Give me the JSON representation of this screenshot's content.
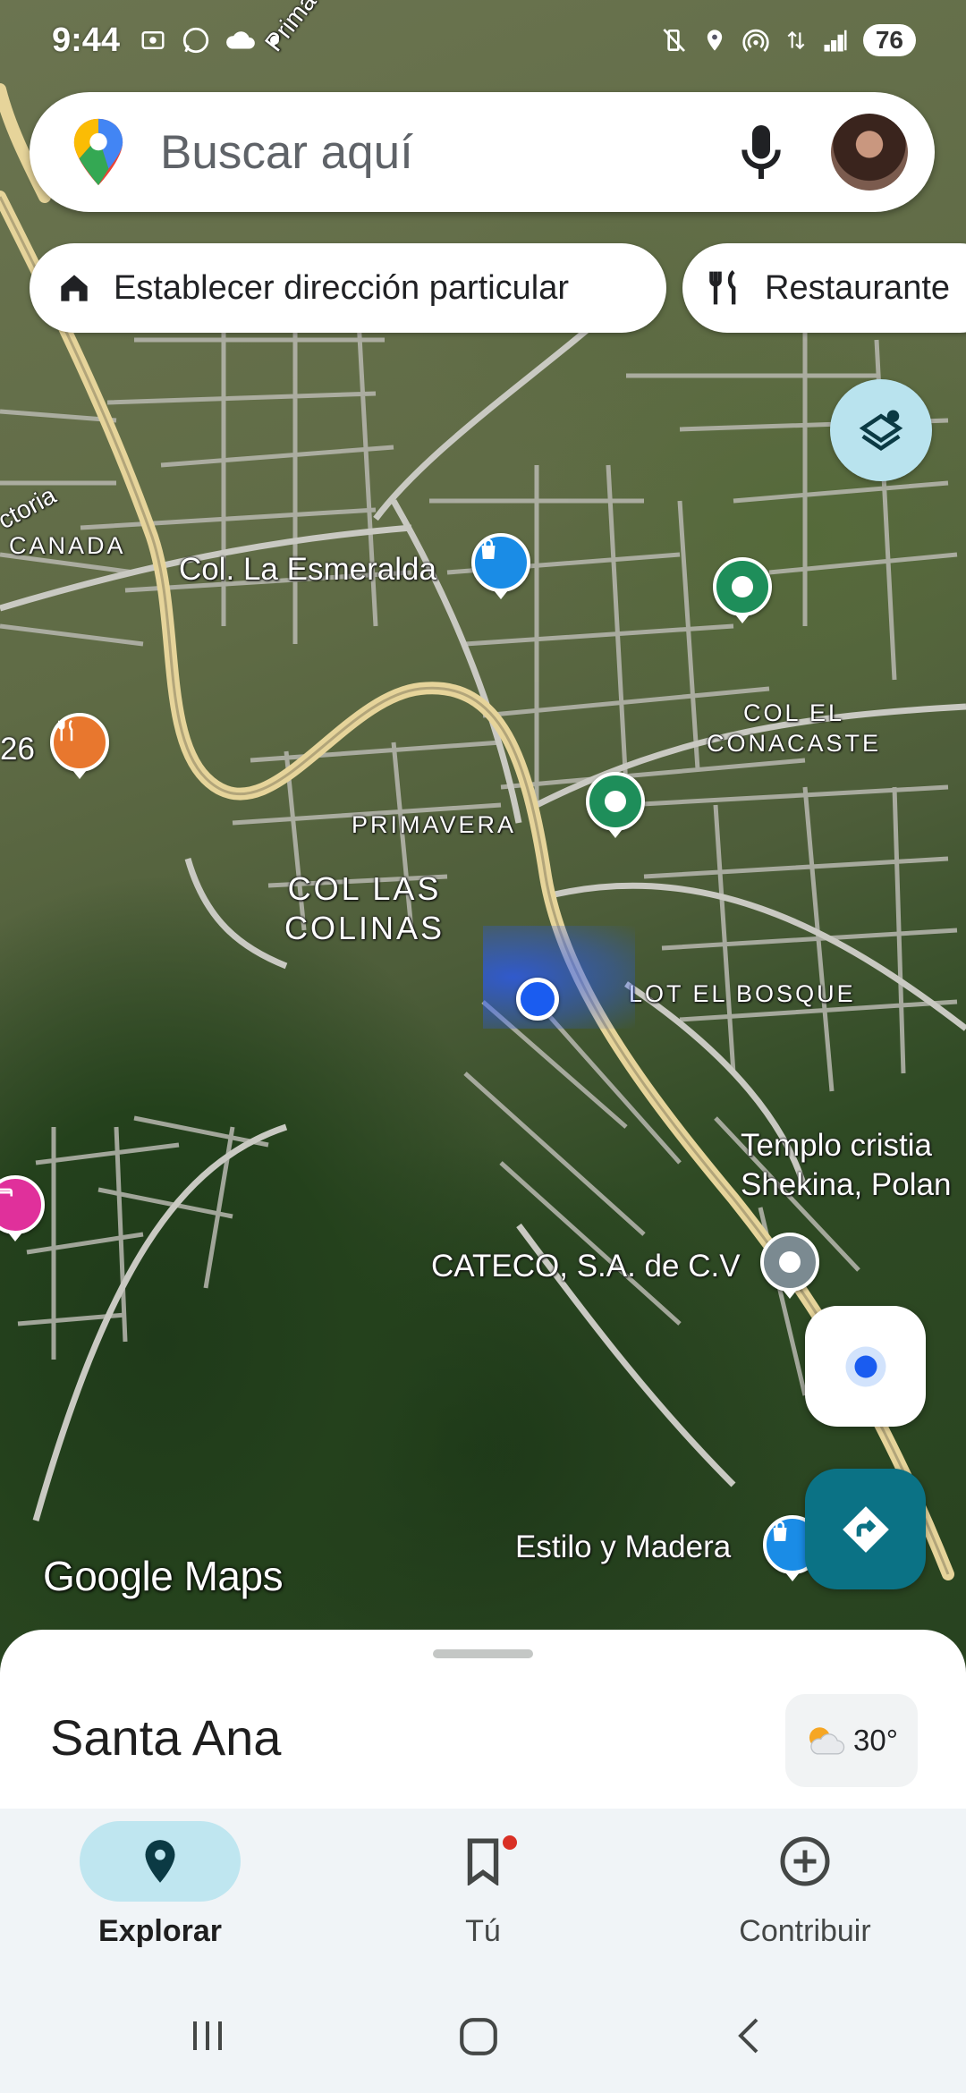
{
  "status_bar": {
    "time": "9:44",
    "battery": "76"
  },
  "search": {
    "placeholder": "Buscar aquí"
  },
  "chips": [
    {
      "label": "Establecer dirección particular",
      "icon": "home-icon"
    },
    {
      "label": "Restaurante",
      "icon": "restaurant-icon"
    }
  ],
  "map": {
    "labels": {
      "street_top": "Primaverita",
      "victoria": "ctoria",
      "canada": "CANADA",
      "la_esmeralda": "Col. La Esmeralda",
      "col_el_conacaste": "COL EL\nCONACASTE",
      "num26": "26",
      "primavera": "PRIMAVERA",
      "col_las_colinas": "COL LAS\nCOLINAS",
      "lot_el_bosque": "LOT EL BOSQUE",
      "templo": "Templo cristia\nShekina, Polan",
      "cateco": "CATECO, S.A. de C.V",
      "estilo": "Estilo y Madera"
    },
    "attribution": "Google Maps"
  },
  "colors": {
    "accent_teal": "#0b7285",
    "location_blue": "#1a5cf0",
    "poi_green": "#1e8e5a",
    "poi_blue": "#1a8ce6",
    "poi_orange": "#e8772e",
    "poi_pink": "#e0309b",
    "poi_gray": "#7b8a91"
  },
  "bottom_sheet": {
    "title": "Santa Ana",
    "weather": "30°"
  },
  "bottom_nav": [
    {
      "label": "Explorar",
      "icon": "location-pin-icon",
      "active": true
    },
    {
      "label": "Tú",
      "icon": "bookmark-icon",
      "active": false
    },
    {
      "label": "Contribuir",
      "icon": "add-circle-icon",
      "active": false
    }
  ]
}
